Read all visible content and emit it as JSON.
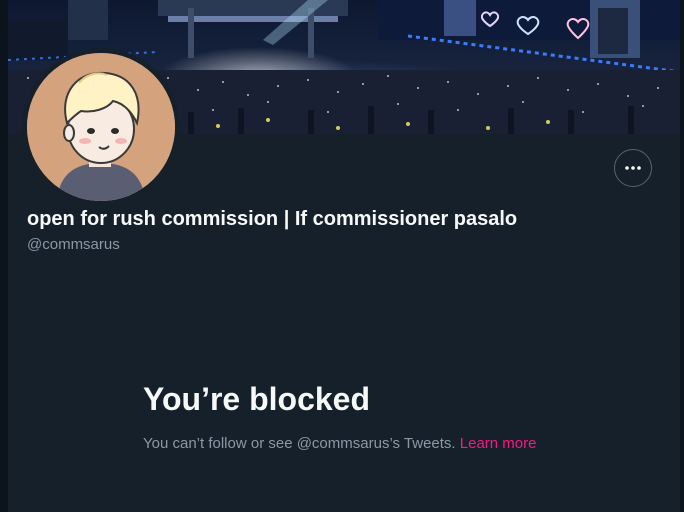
{
  "profile": {
    "display_name": "open for rush commission | If commissioner pasalo",
    "handle": "@commsarus"
  },
  "actions": {
    "more_icon": "more-horizontal-icon"
  },
  "blocked": {
    "title": "You’re blocked",
    "message": "You can’t follow or see @commsarus’s Tweets.",
    "learn_more": "Learn more"
  },
  "colors": {
    "background": "#15202b",
    "primary_text": "#f7f9f9",
    "secondary_text": "#8b98a5",
    "link": "#f91880"
  }
}
